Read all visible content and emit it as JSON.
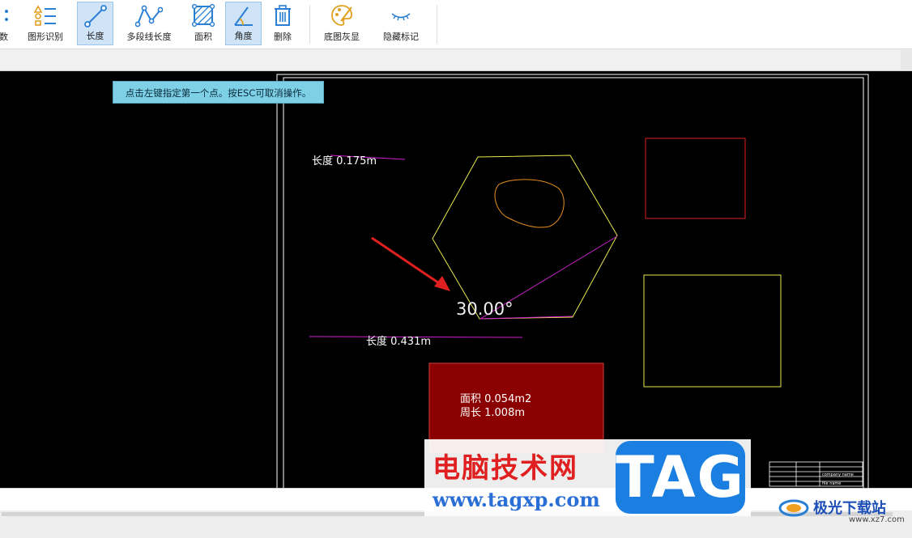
{
  "toolbar": {
    "items": [
      {
        "label": "数",
        "icon": "dots-icon",
        "active": false
      },
      {
        "label": "图形识别",
        "icon": "shape-recognize-icon",
        "active": false
      },
      {
        "label": "长度",
        "icon": "length-icon",
        "active": true
      },
      {
        "label": "多段线长度",
        "icon": "polyline-length-icon",
        "active": false
      },
      {
        "label": "面积",
        "icon": "area-icon",
        "active": false
      },
      {
        "label": "角度",
        "icon": "angle-icon",
        "active": true
      },
      {
        "label": "删除",
        "icon": "trash-icon",
        "active": false
      },
      {
        "label": "底图灰显",
        "icon": "palette-icon",
        "active": false
      },
      {
        "label": "隐藏标记",
        "icon": "eye-closed-icon",
        "active": false
      }
    ]
  },
  "canvas": {
    "hint": "点击左键指定第一个点。按ESC可取消操作。",
    "length_label_1": "长度 0.175m",
    "length_label_2": "长度 0.431m",
    "angle_label": "30.00°",
    "area_label": "面积 0.054m2",
    "perimeter_label": "周长 1.008m",
    "title_block": [
      "company name",
      "file name"
    ]
  },
  "watermark": {
    "title": "电脑技术网",
    "url": "www.tagxp.com",
    "tag": "TAG",
    "site_name": "极光下载站",
    "site_url": "www.xz7.com"
  },
  "colors": {
    "accent": "#2a7fd4",
    "active_bg": "#cfe4f7",
    "hint_bg": "#7dd0e6",
    "magenta": "#d020d0",
    "yellow": "#e8e850",
    "red_rect": "#e02020",
    "dark_red_fill": "#8b0000"
  }
}
